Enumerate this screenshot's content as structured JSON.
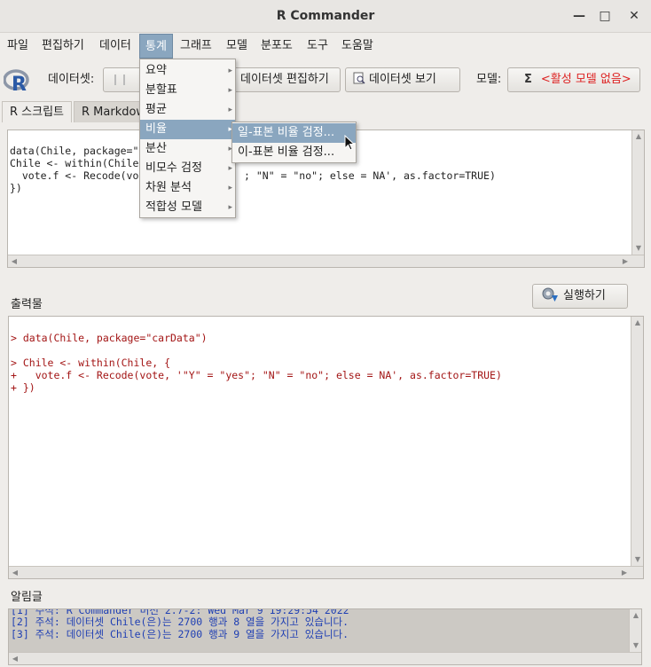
{
  "window": {
    "title": "R Commander"
  },
  "menubar": {
    "items": [
      "파일",
      "편집하기",
      "데이터",
      "통계",
      "그래프",
      "모델",
      "분포도",
      "도구",
      "도움말"
    ]
  },
  "toolbar": {
    "dataset_label": "데이터셋:",
    "dataset_value": "",
    "edit_dataset": "데이터셋 편집하기",
    "view_dataset": "데이터셋 보기",
    "model_label": "모델:",
    "model_value": "<활성 모델 없음>"
  },
  "tabs": [
    "R 스크립트",
    "R Markdown"
  ],
  "script": {
    "lines": [
      "data(Chile, package=\"",
      "Chile <- within(Chile",
      "  vote.f <- Recode(vo",
      "})"
    ],
    "line3_tail": "; \"N\" = \"no\"; else = NA', as.factor=TRUE)"
  },
  "output": {
    "label": "출력물",
    "run_button": "실행하기",
    "lines": [
      "> data(Chile, package=\"carData\")",
      "",
      "> Chile <- within(Chile, {",
      "+   vote.f <- Recode(vote, '\"Y\" = \"yes\"; \"N\" = \"no\"; else = NA', as.factor=TRUE)",
      "+ })"
    ]
  },
  "messages": {
    "label": "알림글",
    "lines": [
      "[1] 주석: R Commander 버전 2.7-2: Wed Mar 9 19:29:54 2022",
      "[2] 주석: 데이터셋 Chile(은)는 2700 행과 8 열을 가지고 있습니다.",
      "[3] 주석: 데이터셋 Chile(은)는 2700 행과 9 열을 가지고 있습니다."
    ]
  },
  "stats_menu": {
    "items": [
      "요약",
      "분할표",
      "평균",
      "비율",
      "분산",
      "비모수 검정",
      "차원 분석",
      "적합성 모델"
    ]
  },
  "proportion_submenu": {
    "items": [
      "일-표본 비율 검정...",
      "이-표본 비율 검정..."
    ]
  },
  "colors": {
    "highlight": "#8aa6bf",
    "output_text": "#a31515",
    "message_text": "#1f3fb3",
    "model_text": "#d22222"
  }
}
